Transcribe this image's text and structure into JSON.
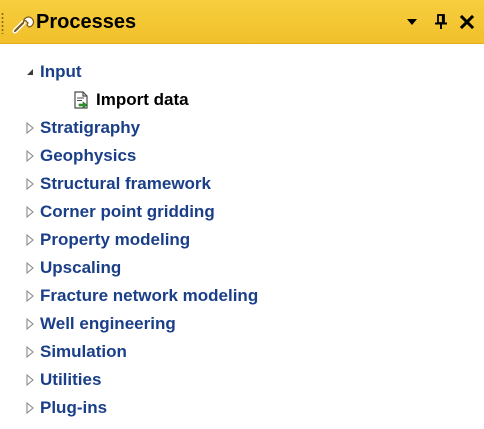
{
  "panel": {
    "title": "Processes",
    "title_icon": "wrench-icon",
    "buttons": {
      "dropdown_icon": "dropdown-arrow-icon",
      "pin_icon": "pin-icon",
      "close_icon": "close-icon"
    },
    "colors": {
      "titlebar": "#f3c634",
      "tree_text": "#1a3f88"
    }
  },
  "tree": {
    "input": {
      "label": "Input",
      "expanded": true,
      "children": [
        {
          "label": "Import data",
          "icon": "import-data-icon"
        }
      ]
    },
    "items": [
      {
        "label": "Stratigraphy"
      },
      {
        "label": "Geophysics"
      },
      {
        "label": "Structural framework"
      },
      {
        "label": "Corner point gridding"
      },
      {
        "label": "Property modeling"
      },
      {
        "label": "Upscaling"
      },
      {
        "label": "Fracture network modeling"
      },
      {
        "label": "Well engineering"
      },
      {
        "label": "Simulation"
      },
      {
        "label": "Utilities"
      },
      {
        "label": "Plug-ins"
      }
    ]
  }
}
